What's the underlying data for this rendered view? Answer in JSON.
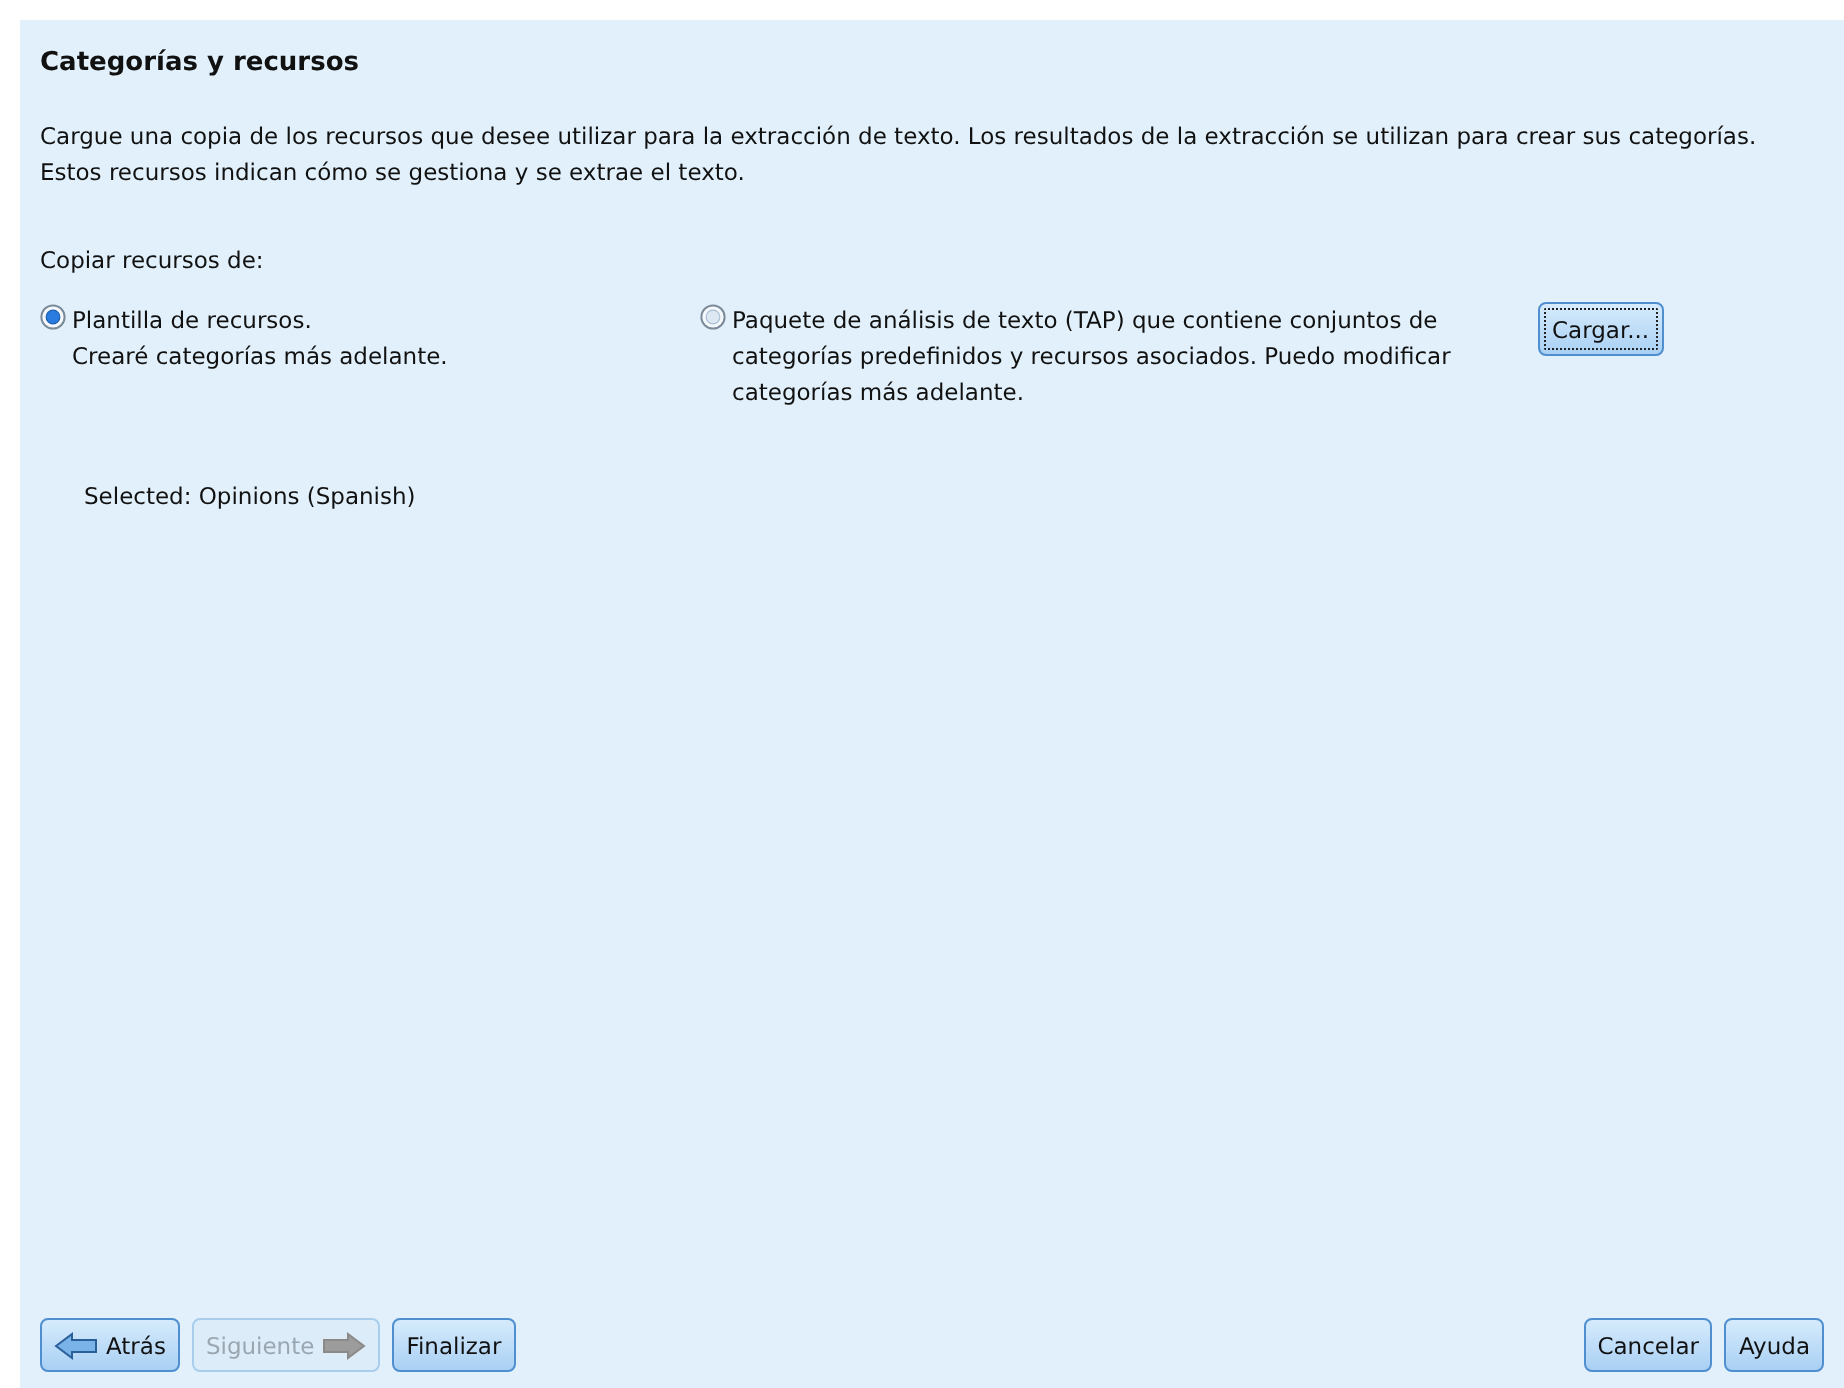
{
  "panel": {
    "title": "Categorías y recursos",
    "description": "Cargue una copia de los recursos que desee utilizar para la extracción de texto. Los resultados de la extracción se utilizan para crear sus categorías. Estos recursos indican cómo se gestiona y se extrae el texto.",
    "copy_label": "Copiar recursos de:",
    "options": [
      {
        "lines": [
          "Plantilla de recursos.",
          "Crearé categorías más adelante."
        ],
        "selected": true
      },
      {
        "lines": [
          "Paquete de análisis de texto (TAP) que contiene conjuntos de categorías predefinidos y recursos asociados. Puedo modificar categorías más adelante."
        ],
        "selected": false,
        "button": "Cargar..."
      }
    ],
    "selected_info": "Selected: Opinions (Spanish)"
  },
  "left_buttons": [
    {
      "label": "Atrás",
      "kind": "back",
      "disabled": false
    },
    {
      "label": "Siguiente",
      "kind": "next",
      "disabled": true
    },
    {
      "label": "Finalizar",
      "kind": "plain",
      "disabled": false
    }
  ],
  "right_buttons": [
    {
      "label": "Cancelar",
      "disabled": false
    },
    {
      "label": "Ayuda",
      "disabled": false
    }
  ]
}
